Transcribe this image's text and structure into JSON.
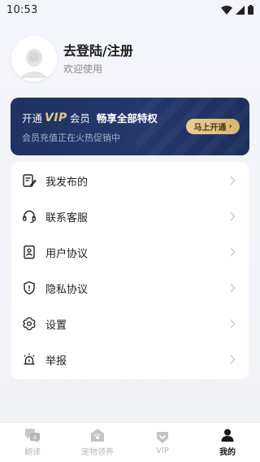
{
  "status_bar": {
    "time": "10:53",
    "icons": [
      "wifi-icon",
      "signal-icon",
      "battery-icon"
    ]
  },
  "profile": {
    "title": "去登陆/注册",
    "subtitle": "欢迎使用"
  },
  "vip": {
    "open": "开通",
    "badge": "VIP",
    "member": "会员",
    "privilege": "畅享全部特权",
    "desc": "会员充值正在火热促销中",
    "button": "马上开通",
    "accent": "#e6c98c",
    "background": "#213566"
  },
  "menu": {
    "items": [
      {
        "label": "我发布的",
        "icon": "edit-icon"
      },
      {
        "label": "联系客服",
        "icon": "headset-icon"
      },
      {
        "label": "用户协议",
        "icon": "user-agreement-icon"
      },
      {
        "label": "隐私协议",
        "icon": "privacy-shield-icon"
      },
      {
        "label": "设置",
        "icon": "gear-icon"
      },
      {
        "label": "举报",
        "icon": "alarm-icon"
      }
    ]
  },
  "tabs": [
    {
      "label": "翻译",
      "icon": "translate-icon",
      "active": false
    },
    {
      "label": "宠物领养",
      "icon": "pet-house-icon",
      "active": false
    },
    {
      "label": "VIP",
      "icon": "vip-heart-icon",
      "active": false
    },
    {
      "label": "我的",
      "icon": "person-icon",
      "active": true
    }
  ]
}
